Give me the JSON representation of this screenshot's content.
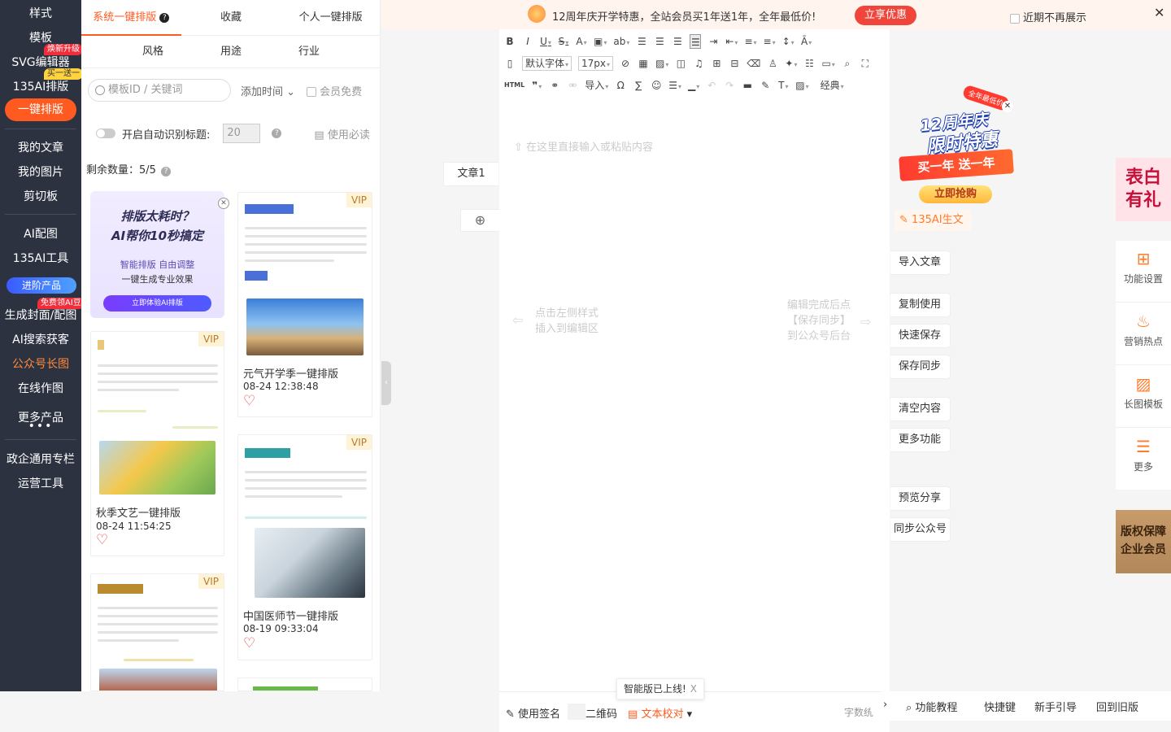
{
  "sidebar": {
    "items": [
      {
        "label": "样式"
      },
      {
        "label": "模板"
      },
      {
        "label": "SVG编辑器",
        "badge": "焕新升级"
      },
      {
        "label": "135AI排版",
        "badge": "买一送一"
      },
      {
        "label": "一键排版"
      },
      {
        "label": "我的文章"
      },
      {
        "label": "我的图片"
      },
      {
        "label": "剪切板"
      },
      {
        "label": "AI配图"
      },
      {
        "label": "135AI工具"
      },
      {
        "label": "进阶产品"
      },
      {
        "label": "生成封面/配图",
        "badge": "免费领AI豆"
      },
      {
        "label": "AI搜索获客"
      },
      {
        "label": "公众号长图"
      },
      {
        "label": "在线作图"
      },
      {
        "label": "更多产品"
      },
      {
        "label": "政企通用专栏"
      },
      {
        "label": "运营工具"
      }
    ]
  },
  "panel": {
    "tabs": [
      {
        "label": "系统一键排版"
      },
      {
        "label": "收藏"
      },
      {
        "label": "个人一键排版"
      }
    ],
    "subtabs": [
      {
        "label": "风格"
      },
      {
        "label": "用途"
      },
      {
        "label": "行业"
      }
    ],
    "search_placeholder": "模板ID / 关键词",
    "sort_label": "添加时间",
    "vip_free_label": "会员免费",
    "auto_title_label": "开启自动识别标题:",
    "auto_title_value": "20",
    "must_read": "使用必读",
    "remaining": "剩余数量：5/5",
    "ai_card": {
      "title1": "排版太耗时？",
      "title2": "AI帮你10秒搞定",
      "sub1": "智能排版 自由调整",
      "sub2": "一键生成专业效果",
      "button": "立即体验AI排版"
    },
    "cards": [
      {
        "title": "秋季文艺一键排版",
        "date": "08-24 11:54:25",
        "vip": "VIP"
      },
      {
        "title": "元气开学季一键排版",
        "date": "08-24 12:38:48",
        "vip": "VIP"
      },
      {
        "title": "中国医师节一键排版",
        "date": "08-19 09:33:04",
        "vip": "VIP"
      },
      {
        "title": "",
        "date": "",
        "vip": "VIP"
      }
    ]
  },
  "banner": {
    "text": "12周年庆开学特惠，全站会员买1年送1年，全年最低价!",
    "button": "立享优惠",
    "checkbox": "近期不再展示"
  },
  "doc_tab": "文章1",
  "editor": {
    "font_select": "默认字体",
    "size_select": "17px",
    "import_label": "导入",
    "classic_label": "经典",
    "html_label": "HTML",
    "placeholder": "在这里直接输入或粘贴内容",
    "hint_left_1": "点击左侧样式",
    "hint_left_2": "插入到编辑区",
    "hint_right_1": "编辑完成后点",
    "hint_right_2": "【保存同步】",
    "hint_right_3": "到公众号后台"
  },
  "promo": {
    "tag": "全年最低价",
    "title1": "12周年庆",
    "title2": "限时特惠",
    "ribbon": "买一年 送一年",
    "buy": "立即抢购"
  },
  "ai_gen": "135AI生文",
  "actions": [
    "导入文章",
    "复制使用",
    "快速保存",
    "保存同步",
    "清空内容",
    "更多功能",
    "预览分享",
    "同步公众号"
  ],
  "right_col": [
    {
      "label": "功能设置",
      "icon": "grid-icon"
    },
    {
      "label": "营销热点",
      "icon": "flame-icon"
    },
    {
      "label": "长图模板",
      "icon": "image-icon"
    },
    {
      "label": "更多",
      "icon": "menu-icon"
    }
  ],
  "gift": {
    "line1": "表白",
    "line2": "有礼"
  },
  "copyright": {
    "line1": "版权保障",
    "line2": "企业会员"
  },
  "bottom": {
    "signature": "使用签名",
    "qrcode": "二维码",
    "proofread": "文本校对",
    "wordcount": "字数统",
    "toast": "智能版已上线!",
    "help": [
      "功能教程",
      "快捷键",
      "新手引导",
      "回到旧版"
    ]
  },
  "colors": {
    "accent": "#ff5a1f",
    "sidebar": "#2c3240",
    "banner_btn": "#f0453a"
  }
}
